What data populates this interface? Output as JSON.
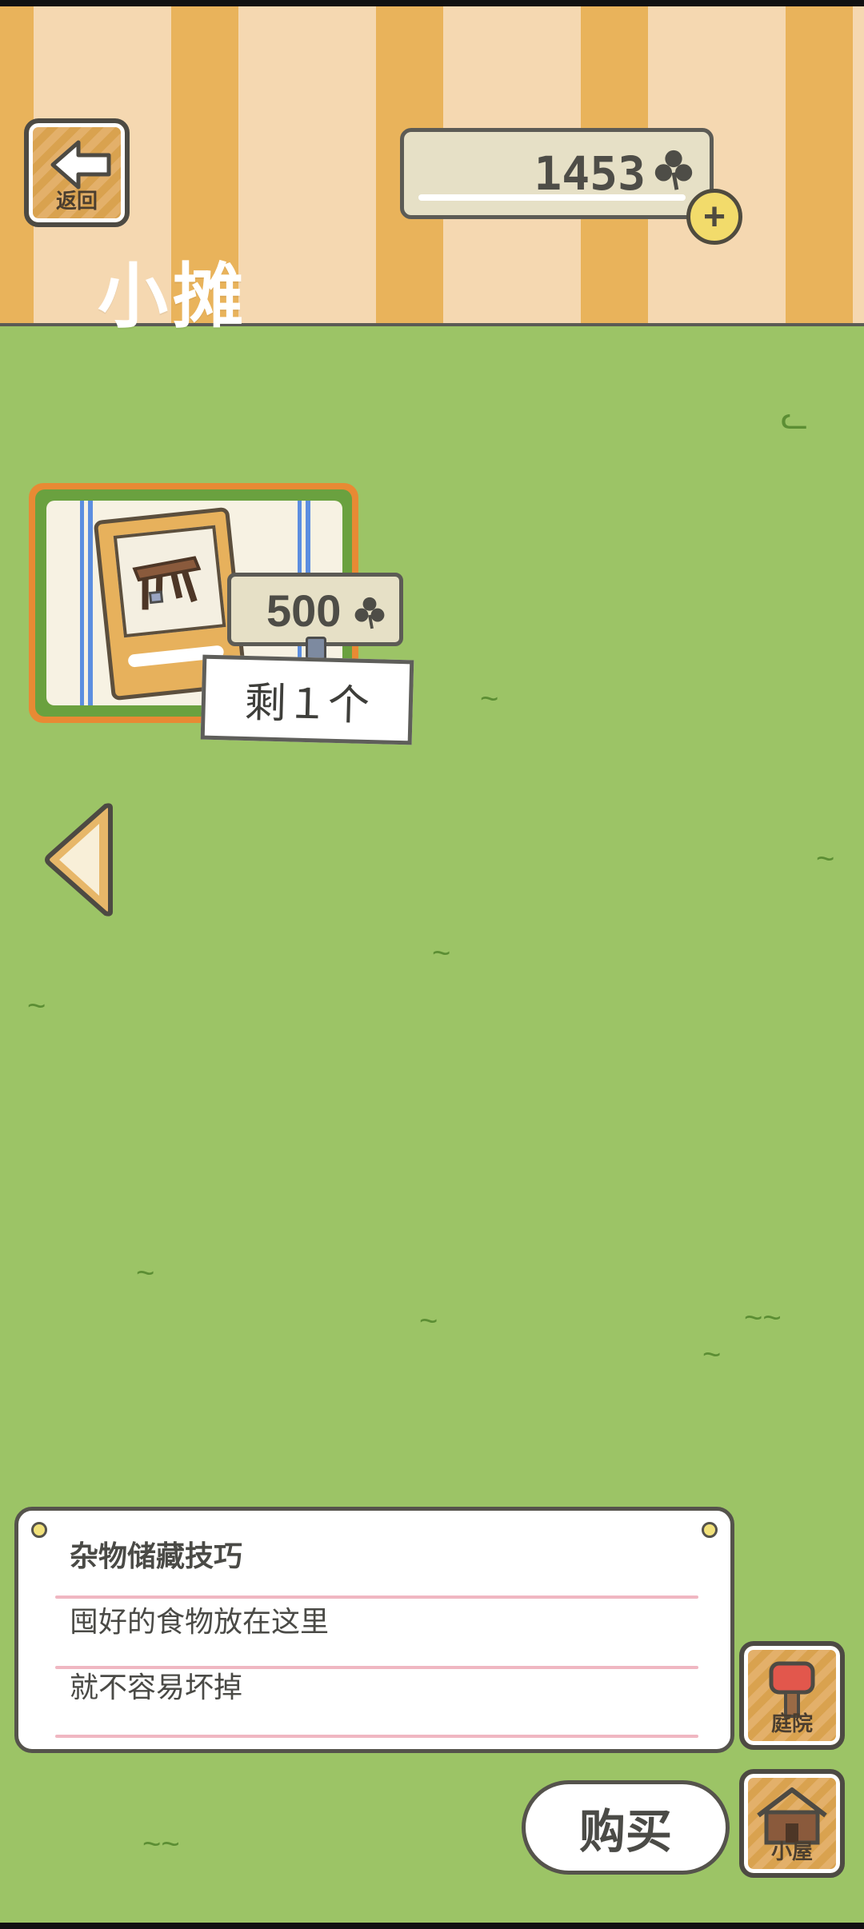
{
  "header": {
    "back_label": "返回",
    "title": "小摊",
    "currency_amount": "1453",
    "currency_icon": "clover-icon",
    "add_icon": "plus-icon"
  },
  "item": {
    "price": "500",
    "remaining": "剩１个",
    "price_icon": "clover-icon"
  },
  "dialog": {
    "lines": [
      "杂物储藏技巧",
      "囤好的食物放在这里",
      "就不容易坏掉"
    ]
  },
  "actions": {
    "buy_label": "购买",
    "yard_label": "庭院",
    "house_label": "小屋"
  },
  "colors": {
    "grass": "#9cc466",
    "stripe_orange": "#e9b35b",
    "stripe_light": "#f5d8b1",
    "card_border": "#e88a34"
  }
}
